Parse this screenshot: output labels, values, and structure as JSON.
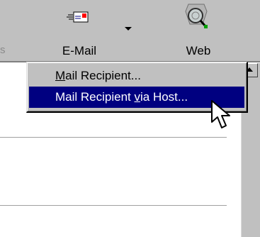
{
  "toolbar": {
    "cut_label": "s",
    "email_label": "E-Mail",
    "web_label": "Web"
  },
  "menu": {
    "items": [
      {
        "pre": "",
        "accel": "M",
        "post": "ail Recipient..."
      },
      {
        "pre": "Mail Recipient ",
        "accel": "v",
        "post": "ia Host..."
      }
    ],
    "highlighted_index": 1
  },
  "colors": {
    "toolbar_bg": "#c0c0c0",
    "menu_highlight": "#000080"
  },
  "icons": [
    "email-icon",
    "web-globe-icon",
    "dropdown-arrow-icon",
    "mouse-pointer-icon",
    "scroll-up-arrow-icon"
  ]
}
